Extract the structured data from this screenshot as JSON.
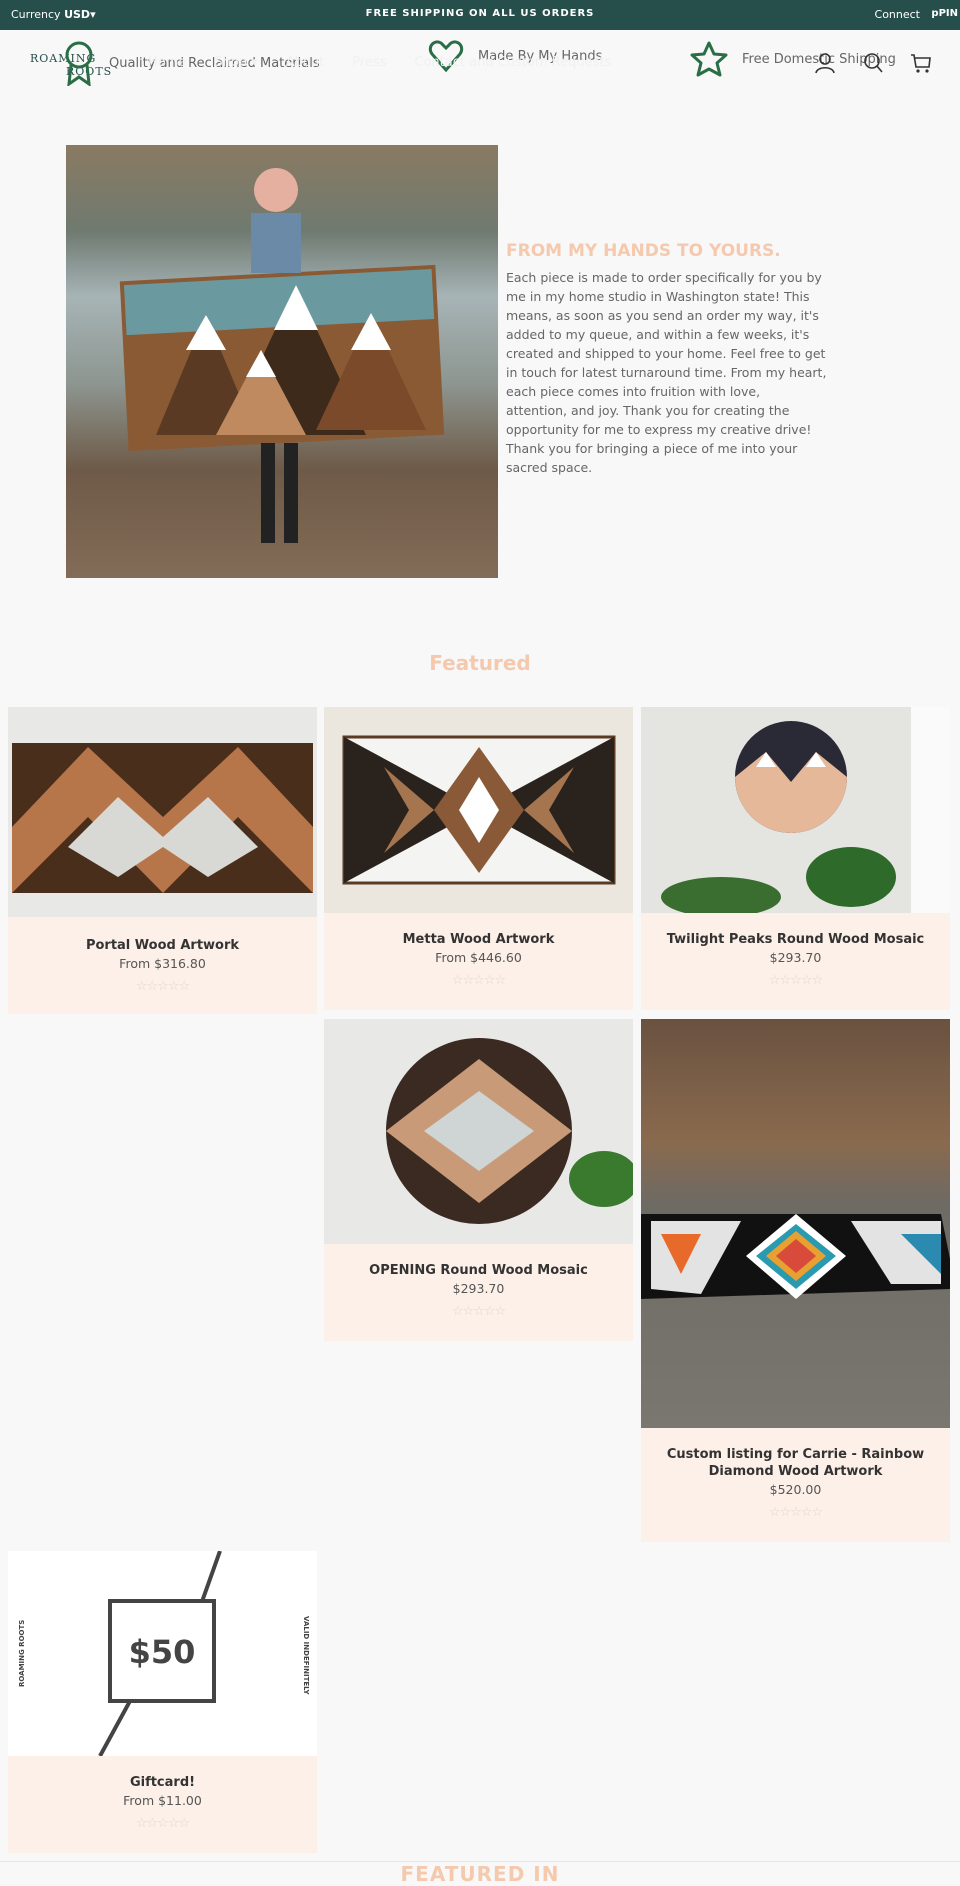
{
  "topbar": {
    "currency_label": "Currency",
    "currency_value": "USD",
    "announcement": "FREE SHIPPING ON ALL US ORDERS",
    "connect": "Connect",
    "pinterest": "pPIN"
  },
  "header": {
    "logo_line1": "ROAMING",
    "logo_line2": "ROOTS",
    "features": [
      {
        "icon": "ribbon-icon",
        "label": "Quality and Reclaimed Materials"
      },
      {
        "icon": "heart-icon",
        "label": "Made By My Hands"
      },
      {
        "icon": "star-icon",
        "label": "Free Domestic Shipping"
      }
    ],
    "nav": [
      "Home",
      "Shop ▾",
      "About",
      "Press",
      "Contact and Custom Requests"
    ],
    "icons": [
      "account-icon",
      "search-icon",
      "cart-icon"
    ],
    "accent": "#2a6e46"
  },
  "hero": {
    "heading": "FROM MY HANDS TO YOURS.",
    "body": "Each piece is made to order specifically for you by\nme in my home studio in Washington state! This\nmeans, as soon as you send an order my way, it's\nadded to my queue, and within a few weeks, it's\ncreated and shipped to your home.            Feel free to get\nin touch for latest turnaround time.                From my heart,\neach piece comes into fruition with love,\nattention, and joy.            Thank you for creating the\nopportunity for me to express my creative drive!\nThank you for bringing a piece of me into your\nsacred space."
  },
  "featured": {
    "title": "Featured",
    "products": [
      {
        "title": "Portal Wood Artwork",
        "price": "From  $316.80",
        "stars": "☆☆☆☆☆",
        "rating": 0
      },
      {
        "title": "Metta Wood Artwork",
        "price": "From  $446.60",
        "stars": "☆☆☆☆☆",
        "rating": 0
      },
      {
        "title": "Twilight Peaks Round Wood Mosaic",
        "price": "$293.70",
        "stars": "☆☆☆☆☆",
        "rating": 0
      },
      {
        "title": "OPENING Round Wood Mosaic",
        "price": "$293.70",
        "stars": "☆☆☆☆☆",
        "rating": 0
      },
      {
        "title": "Custom listing for Carrie - Rainbow Diamond Wood Artwork",
        "price": "$520.00",
        "stars": "☆☆☆☆☆",
        "rating": 0
      },
      {
        "title": "Giftcard!",
        "price": "From  $11.00",
        "stars": "☆☆☆☆☆",
        "rating": 0,
        "image_text": {
          "amount": "$50",
          "left": "ROAMING ROOTS",
          "right": "VALID INDEFINITELY"
        }
      }
    ]
  },
  "featured_in": {
    "title": "FEATURED IN"
  },
  "colors": {
    "topbar": "#264f4c",
    "accent_peach": "#f5c9ae",
    "card_bg": "#fdf0e8"
  }
}
